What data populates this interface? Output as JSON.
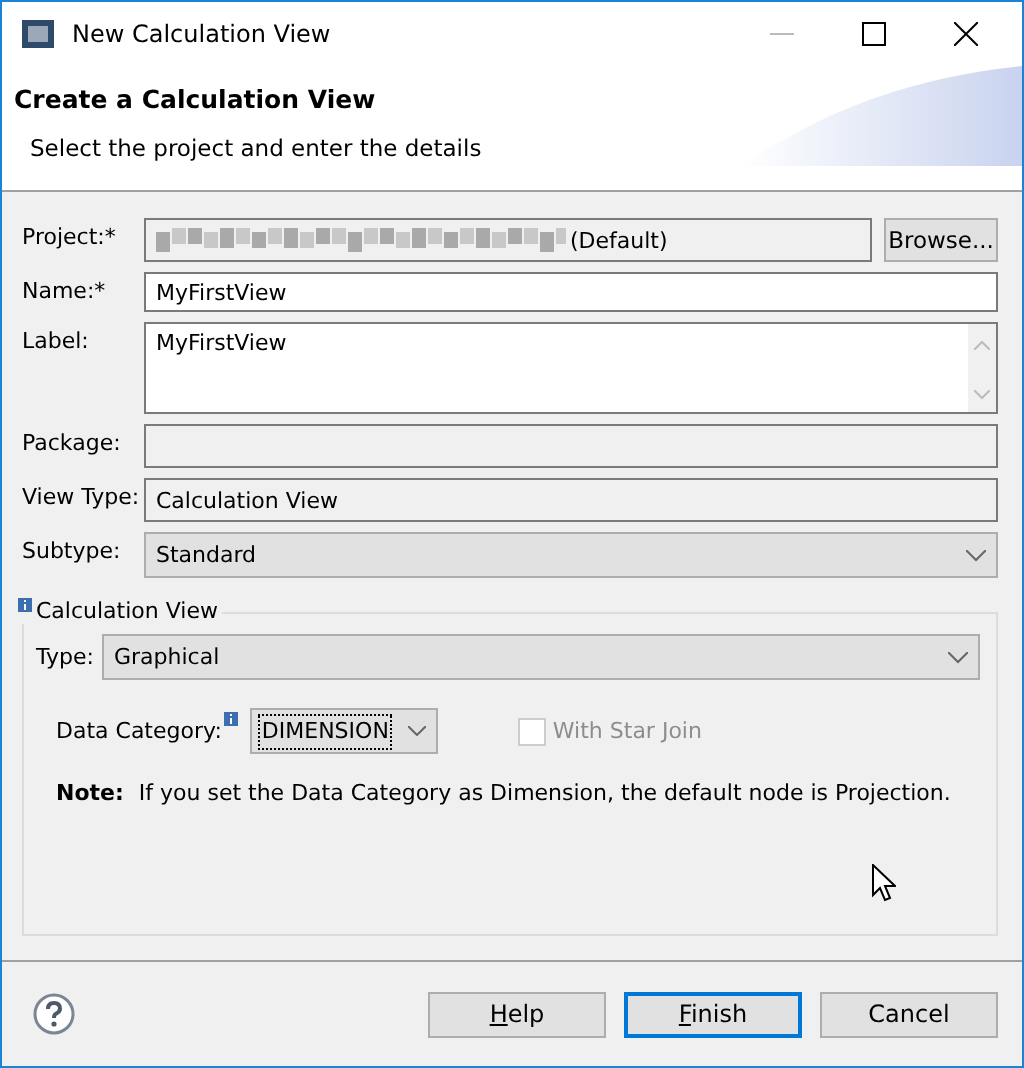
{
  "window": {
    "title": "New Calculation View"
  },
  "header": {
    "title": "Create a Calculation View",
    "subtitle": "Select the project and enter the details"
  },
  "fields": [
    {
      "kind": "readonly",
      "label": "Project:*",
      "value": "(Default)",
      "blurred": true,
      "button": "Browse..."
    },
    {
      "kind": "text",
      "label": "Name:*",
      "value": "MyFirstView"
    },
    {
      "kind": "textarea",
      "label": "Label:",
      "value": "MyFirstView"
    },
    {
      "kind": "readonly",
      "label": "Package:"
    },
    {
      "kind": "readonly",
      "label": "View Type:",
      "value": "Calculation View"
    },
    {
      "kind": "select",
      "label": "Subtype:",
      "value": "Standard"
    }
  ],
  "group": {
    "title": "Calculation View",
    "type_label": "Type:",
    "type_value": "Graphical",
    "data_category_label": "Data Category:",
    "data_category_value": "DIMENSION",
    "star_join": {
      "label": "With Star Join",
      "checked": false,
      "disabled": true
    },
    "note_label": "Note:",
    "note_text": "If you set the Data Category as Dimension, the default node is Projection."
  },
  "buttons": [
    {
      "mnemonic": "H",
      "rest": "elp",
      "default": false
    },
    {
      "mnemonic": "F",
      "rest": "inish",
      "default": true
    },
    {
      "rest": "Cancel",
      "default": false
    }
  ]
}
